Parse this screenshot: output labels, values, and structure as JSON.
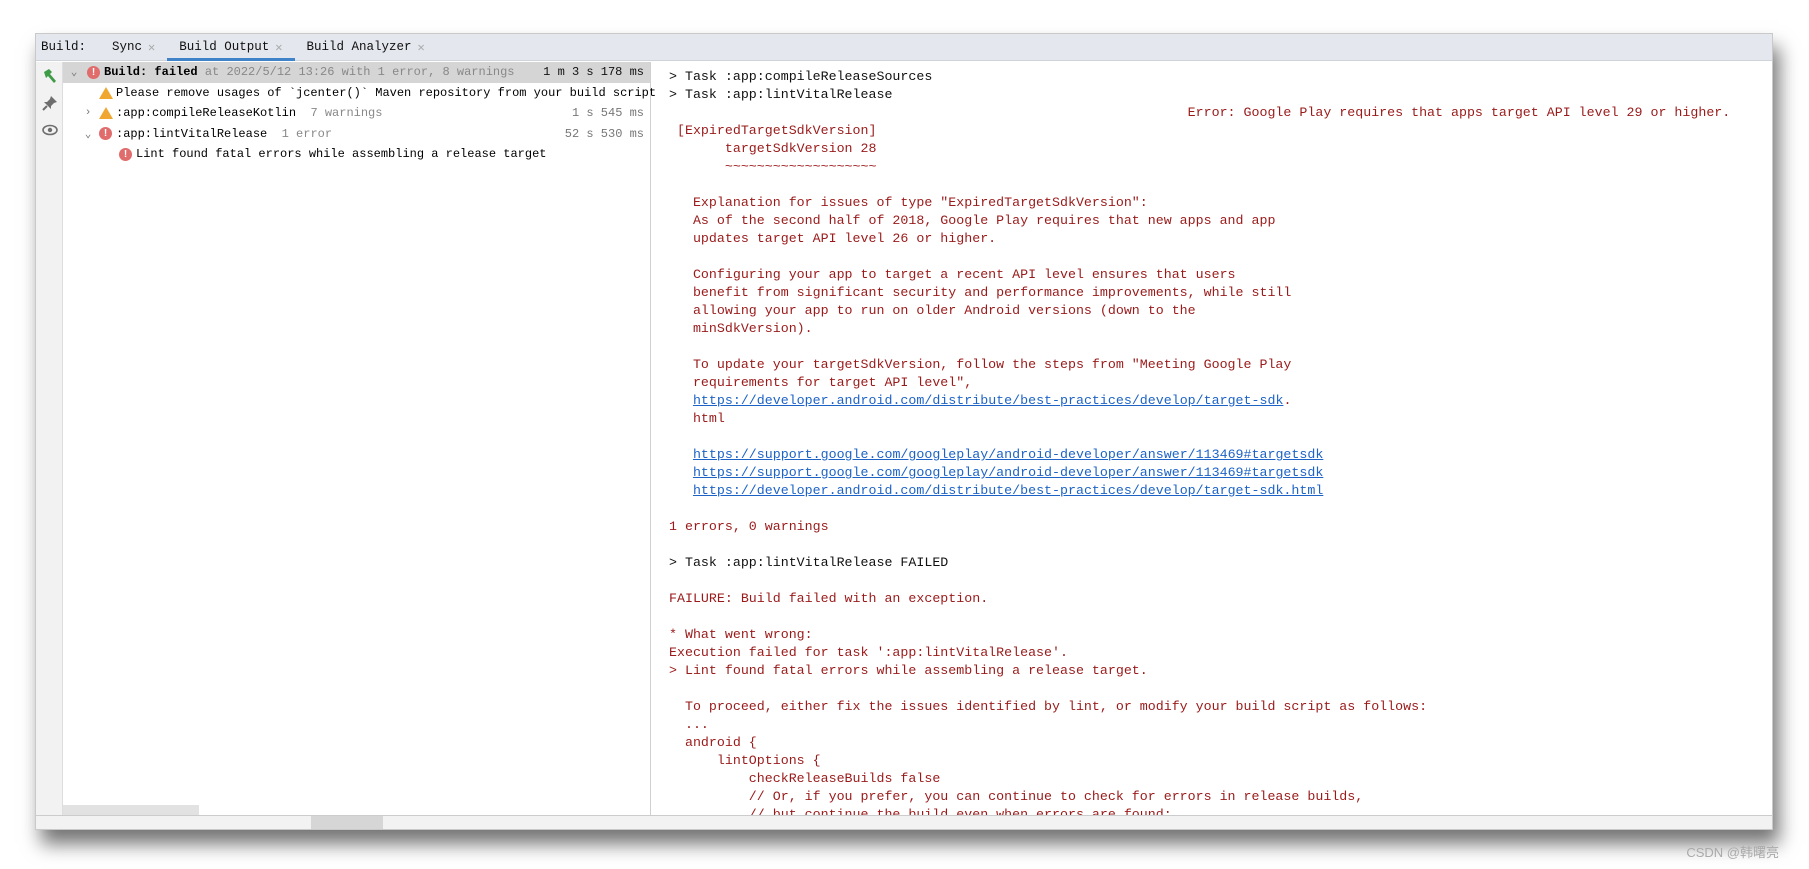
{
  "tabs": {
    "label": "Build:",
    "items": [
      {
        "label": "Sync",
        "active": false
      },
      {
        "label": "Build Output",
        "active": true
      },
      {
        "label": "Build Analyzer",
        "active": false
      }
    ]
  },
  "toolstrip": [
    "hammer-icon",
    "pin-icon",
    "eye-icon"
  ],
  "tree": {
    "root": {
      "title": "Build:",
      "status": "failed",
      "detail": " at 2022/5/12 13:26 with 1 error, 8 warnings",
      "duration": "1 m 3 s 178 ms"
    },
    "items": [
      {
        "type": "warning",
        "label": "Please remove usages of `jcenter()` Maven repository from your build script",
        "expandable": false,
        "indent": 1
      },
      {
        "type": "warning",
        "label": ":app:compileReleaseKotlin",
        "extra": "7 warnings",
        "duration": "1 s 545 ms",
        "expandable": true,
        "expanded": false,
        "indent": 0
      },
      {
        "type": "error",
        "label": ":app:lintVitalRelease",
        "extra": "1 error",
        "duration": "52 s 530 ms",
        "expandable": true,
        "expanded": true,
        "indent": 0
      },
      {
        "type": "error",
        "label": "Lint found fatal errors while assembling a release target",
        "indent": 2
      }
    ]
  },
  "console": [
    {
      "t": "> Task :app:compileReleaseSources",
      "c": "k"
    },
    {
      "t": "> Task :app:lintVitalRelease",
      "c": "k"
    },
    {
      "t": "                                                                 Error: Google Play requires that apps target API level 29 or higher."
    },
    {
      "t": " [ExpiredTargetSdkVersion]"
    },
    {
      "t": "       targetSdkVersion 28"
    },
    {
      "t": "       ~~~~~~~~~~~~~~~~~~~"
    },
    {
      "t": ""
    },
    {
      "t": "   Explanation for issues of type \"ExpiredTargetSdkVersion\":"
    },
    {
      "t": "   As of the second half of 2018, Google Play requires that new apps and app"
    },
    {
      "t": "   updates target API level 26 or higher."
    },
    {
      "t": ""
    },
    {
      "t": "   Configuring your app to target a recent API level ensures that users"
    },
    {
      "t": "   benefit from significant security and performance improvements, while still"
    },
    {
      "t": "   allowing your app to run on older Android versions (down to the"
    },
    {
      "t": "   minSdkVersion)."
    },
    {
      "t": ""
    },
    {
      "t": "   To update your targetSdkVersion, follow the steps from \"Meeting Google Play"
    },
    {
      "t": "   requirements for target API level\","
    },
    {
      "t": "   ",
      "link": "https://developer.android.com/distribute/best-practices/develop/target-sdk",
      "after": "."
    },
    {
      "t": "   html"
    },
    {
      "t": ""
    },
    {
      "t": "   ",
      "link": "https://support.google.com/googleplay/android-developer/answer/113469#targetsdk"
    },
    {
      "t": "   ",
      "link": "https://support.google.com/googleplay/android-developer/answer/113469#targetsdk"
    },
    {
      "t": "   ",
      "link": "https://developer.android.com/distribute/best-practices/develop/target-sdk.html"
    },
    {
      "t": ""
    },
    {
      "t": "1 errors, 0 warnings"
    },
    {
      "t": ""
    },
    {
      "t": "> Task :app:lintVitalRelease FAILED",
      "c": "k"
    },
    {
      "t": ""
    },
    {
      "t": "FAILURE: Build failed with an exception."
    },
    {
      "t": ""
    },
    {
      "t": "* What went wrong:"
    },
    {
      "t": "Execution failed for task ':app:lintVitalRelease'."
    },
    {
      "t": "> Lint found fatal errors while assembling a release target."
    },
    {
      "t": ""
    },
    {
      "t": "  To proceed, either fix the issues identified by lint, or modify your build script as follows:"
    },
    {
      "t": "  ..."
    },
    {
      "t": "  android {"
    },
    {
      "t": "      lintOptions {"
    },
    {
      "t": "          checkReleaseBuilds false"
    },
    {
      "t": "          // Or, if you prefer, you can continue to check for errors in release builds,"
    },
    {
      "t": "          // but continue the build even when errors are found:"
    }
  ],
  "watermark": "CSDN @韩曙亮",
  "colors": {
    "error_text": "#9a1a1a",
    "link": "#1d63c6",
    "accent": "#4083c9",
    "error_icon": "#e06c6c",
    "warning_icon": "#f0a732"
  }
}
